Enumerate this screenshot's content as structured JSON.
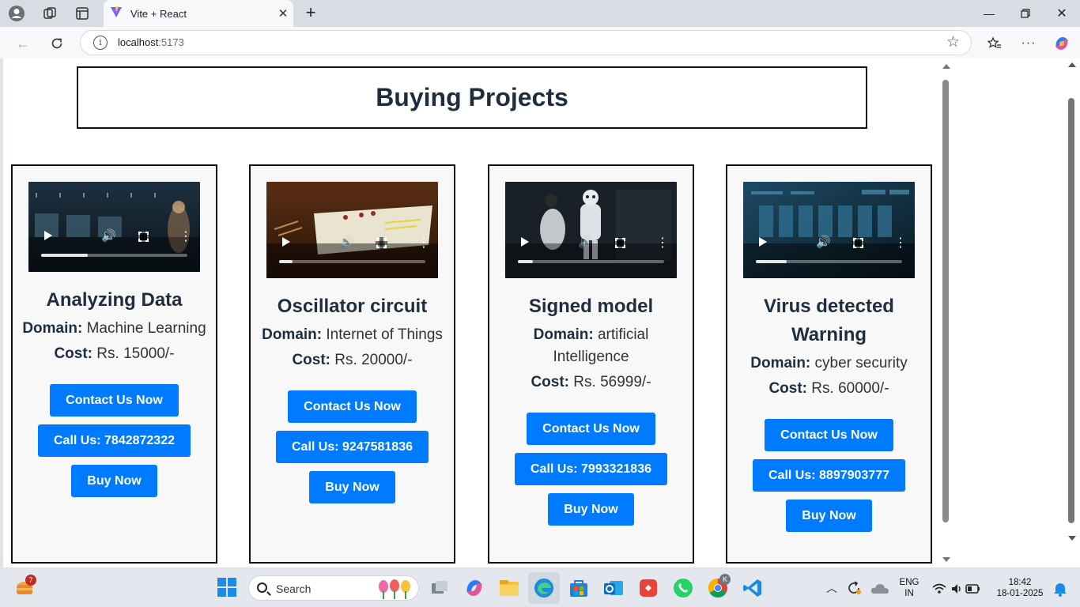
{
  "browser": {
    "tab_title": "Vite + React",
    "url_host": "localhost",
    "url_port": ":5173"
  },
  "page": {
    "heading": "Buying Projects",
    "domain_label": "Domain:",
    "cost_label": "Cost:",
    "contact_label": "Contact Us Now",
    "buy_label": "Buy Now",
    "cards": [
      {
        "title": "Analyzing Data",
        "domain": "Machine Learning",
        "cost": "Rs. 15000/-",
        "call": "Call Us: 7842872322",
        "video_progress": 0.32
      },
      {
        "title": "Oscillator circuit",
        "domain": "Internet of Things",
        "cost": "Rs. 20000/-",
        "call": "Call Us: 9247581836",
        "video_progress": 0.09
      },
      {
        "title": "Signed model",
        "domain": "artificial Intelligence",
        "cost": "Rs. 56999/-",
        "call": "Call Us: 7993321836",
        "video_progress": 0.1
      },
      {
        "title": "Virus detected Warning",
        "domain": "cyber security",
        "cost": "Rs. 60000/-",
        "call": "Call Us: 8897903777",
        "video_progress": 0.21
      }
    ]
  },
  "taskbar": {
    "search_placeholder": "Search",
    "widget_badge": "7",
    "chrome_badge": "K",
    "lang_line1": "ENG",
    "lang_line2": "IN",
    "time": "18:42",
    "date": "18-01-2025"
  },
  "colors": {
    "accent": "#007bff",
    "heading_text": "#1f2d3d"
  }
}
